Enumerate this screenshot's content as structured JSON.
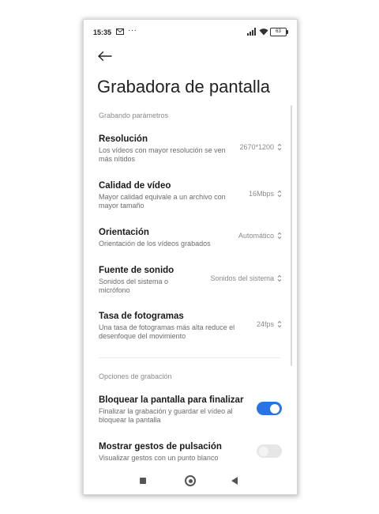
{
  "status_bar": {
    "time": "15:35",
    "dots": "···",
    "battery": "63"
  },
  "header": {
    "title": "Grabadora de pantalla"
  },
  "sections": {
    "recording_params": "Grabando parámetros",
    "recording_options": "Opciones de grabación"
  },
  "settings": [
    {
      "title": "Resolución",
      "description": "Los vídeos con mayor resolución se ven más nítidos",
      "value": "2670*1200"
    },
    {
      "title": "Calidad de vídeo",
      "description": "Mayor calidad equivale a un archivo con mayor tamaño",
      "value": "16Mbps"
    },
    {
      "title": "Orientación",
      "description": "Orientación de los vídeos grabados",
      "value": "Automático"
    },
    {
      "title": "Fuente de sonido",
      "description": "Sonidos del sistema o micrófono",
      "value": "Sonidos del sistema"
    },
    {
      "title": "Tasa de fotogramas",
      "description": "Una tasa de fotogramas más alta reduce el desenfoque del movimiento",
      "value": "24fps"
    }
  ],
  "options": [
    {
      "title": "Bloquear la pantalla para finalizar",
      "description": "Finalizar la grabación y guardar el vídeo al bloquear la pantalla",
      "enabled": true
    },
    {
      "title": "Mostrar gestos de pulsación",
      "description": "Visualizar gestos con un punto blanco",
      "enabled": false
    }
  ],
  "colors": {
    "accent": "#2a73e6",
    "toggle_off": "#e6e6e6"
  },
  "icons": {
    "back": "arrow-left-icon",
    "selector": "up-down-chevron-icon",
    "nav_recents": "square-icon",
    "nav_home": "circle-icon",
    "nav_back": "triangle-left-icon"
  }
}
